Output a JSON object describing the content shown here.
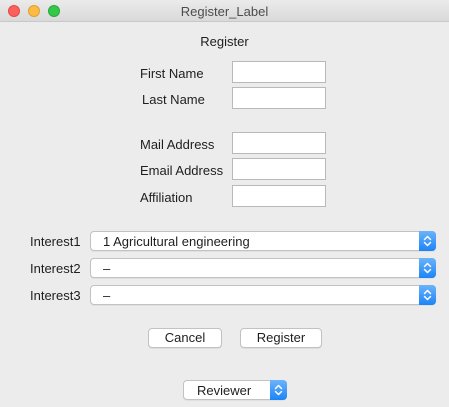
{
  "window": {
    "title": "Register_Label"
  },
  "form": {
    "heading": "Register",
    "first_name_label": "First Name",
    "first_name_value": "",
    "last_name_label": "Last Name",
    "last_name_value": "",
    "mail_address_label": "Mail Address",
    "mail_address_value": "",
    "email_address_label": "Email Address",
    "email_address_value": "",
    "affiliation_label": "Affiliation",
    "affiliation_value": ""
  },
  "interests": [
    {
      "label": "Interest1",
      "selected": "1 Agricultural engineering"
    },
    {
      "label": "Interest2",
      "selected": "–"
    },
    {
      "label": "Interest3",
      "selected": "–"
    }
  ],
  "actions": {
    "cancel_label": "Cancel",
    "register_label": "Register"
  },
  "role": {
    "selected": "Reviewer"
  },
  "colors": {
    "accent": "#1c84f7",
    "close": "#fc605c",
    "minimize": "#fdbc40",
    "zoom": "#34c84a",
    "window_bg": "#ececec"
  }
}
